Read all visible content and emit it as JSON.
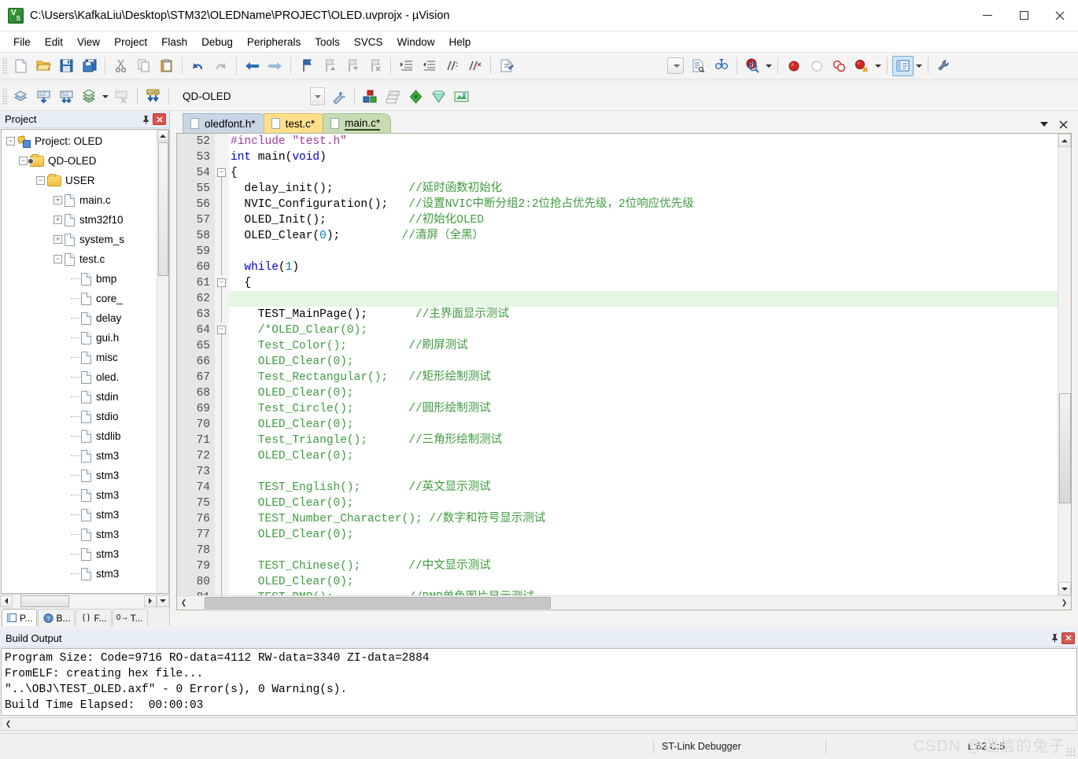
{
  "window": {
    "title": "C:\\Users\\KafkaLiu\\Desktop\\STM32\\OLEDName\\PROJECT\\OLED.uvprojx - µVision",
    "icon": "uvision-icon",
    "minimize": "–",
    "maximize": "□",
    "close": "✕"
  },
  "menu": [
    "File",
    "Edit",
    "View",
    "Project",
    "Flash",
    "Debug",
    "Peripherals",
    "Tools",
    "SVCS",
    "Window",
    "Help"
  ],
  "toolbar_main": [
    {
      "name": "new-file-icon",
      "glyph": "new"
    },
    {
      "name": "open-file-icon",
      "glyph": "open"
    },
    {
      "name": "save-icon",
      "glyph": "save"
    },
    {
      "name": "save-all-icon",
      "glyph": "saveall"
    },
    {
      "name": "sep",
      "glyph": "sep"
    },
    {
      "name": "cut-icon",
      "glyph": "cut"
    },
    {
      "name": "copy-icon",
      "glyph": "copy"
    },
    {
      "name": "paste-icon",
      "glyph": "paste"
    },
    {
      "name": "sep",
      "glyph": "sep"
    },
    {
      "name": "undo-icon",
      "glyph": "undo"
    },
    {
      "name": "redo-icon",
      "glyph": "redo"
    },
    {
      "name": "sep",
      "glyph": "sep"
    },
    {
      "name": "navigate-back-icon",
      "glyph": "back"
    },
    {
      "name": "navigate-forward-icon",
      "glyph": "fwd"
    },
    {
      "name": "sep",
      "glyph": "sep"
    },
    {
      "name": "bookmark-toggle-icon",
      "glyph": "bm1"
    },
    {
      "name": "bookmark-prev-icon",
      "glyph": "bm2"
    },
    {
      "name": "bookmark-next-icon",
      "glyph": "bm3"
    },
    {
      "name": "bookmark-clear-icon",
      "glyph": "bm4"
    },
    {
      "name": "sep",
      "glyph": "sep"
    },
    {
      "name": "indent-right-icon",
      "glyph": "ind1"
    },
    {
      "name": "indent-left-icon",
      "glyph": "ind2"
    },
    {
      "name": "comment-lines-icon",
      "glyph": "cmt1"
    },
    {
      "name": "uncomment-lines-icon",
      "glyph": "cmt2"
    },
    {
      "name": "sep",
      "glyph": "sep"
    },
    {
      "name": "open-include-file-icon",
      "glyph": "incl"
    }
  ],
  "toolbar_main_right": [
    {
      "name": "target-dropdown-icon",
      "glyph": "cbtn"
    },
    {
      "name": "insert-readwrite-breakpoint-icon",
      "glyph": "doc1"
    },
    {
      "name": "find-in-files-icon",
      "glyph": "binoc"
    },
    {
      "name": "sep",
      "glyph": "sep"
    },
    {
      "name": "debug-query-icon",
      "glyph": "magq"
    },
    {
      "name": "arrow",
      "glyph": "arrow"
    },
    {
      "name": "sep",
      "glyph": "sep"
    },
    {
      "name": "insert-breakpoint-icon",
      "glyph": "bp-red"
    },
    {
      "name": "disable-breakpoint-icon",
      "glyph": "bp-hollow"
    },
    {
      "name": "disable-all-breakpoints-icon",
      "glyph": "bp-two"
    },
    {
      "name": "kill-all-breakpoints-icon",
      "glyph": "bp-x"
    },
    {
      "name": "arrow",
      "glyph": "arrow"
    },
    {
      "name": "sep",
      "glyph": "sep"
    },
    {
      "name": "project-window-icon",
      "glyph": "panel",
      "active": true
    },
    {
      "name": "arrow",
      "glyph": "arrow"
    },
    {
      "name": "sep",
      "glyph": "sep"
    },
    {
      "name": "configure-target-icon",
      "glyph": "wrench"
    }
  ],
  "toolbar_build": [
    {
      "name": "translate-file-icon",
      "glyph": "trans"
    },
    {
      "name": "build-target-icon",
      "glyph": "build"
    },
    {
      "name": "rebuild-all-icon",
      "glyph": "rebuild"
    },
    {
      "name": "batch-build-icon",
      "glyph": "batch"
    },
    {
      "name": "arrow",
      "glyph": "arrow"
    },
    {
      "name": "stop-build-icon",
      "glyph": "stopbuild"
    },
    {
      "name": "sep",
      "glyph": "sep"
    },
    {
      "name": "download-icon",
      "glyph": "load"
    },
    {
      "name": "sep",
      "glyph": "sep"
    }
  ],
  "target_select": {
    "value": "QD-OLED",
    "name": "target-combo"
  },
  "toolbar_build_right": [
    {
      "name": "target-options-icon",
      "glyph": "magic"
    },
    {
      "name": "sep",
      "glyph": "sep"
    },
    {
      "name": "manage-project-items-icon",
      "glyph": "cubes"
    },
    {
      "name": "manage-multi-project-icon",
      "glyph": "layers"
    },
    {
      "name": "pack-installer-icon",
      "glyph": "diamond-green"
    },
    {
      "name": "manage-run-time-env-icon",
      "glyph": "diamond-light"
    },
    {
      "name": "select-software-packs-icon",
      "glyph": "packs"
    }
  ],
  "project_panel": {
    "title": "Project",
    "pin": "📌",
    "close": "✕",
    "tree": [
      {
        "label": "Project: OLED",
        "indent": 0,
        "expander": "-",
        "icon": "project-icon"
      },
      {
        "label": "QD-OLED",
        "indent": 1,
        "expander": "-",
        "icon": "target-folder-icon"
      },
      {
        "label": "USER",
        "indent": 2,
        "expander": "-",
        "icon": "group-folder-icon"
      },
      {
        "label": "main.c",
        "indent": 3,
        "expander": "+",
        "icon": "c-file-icon"
      },
      {
        "label": "stm32f10",
        "indent": 3,
        "expander": "+",
        "icon": "c-file-icon"
      },
      {
        "label": "system_s",
        "indent": 3,
        "expander": "+",
        "icon": "c-file-icon"
      },
      {
        "label": "test.c",
        "indent": 3,
        "expander": "-",
        "icon": "c-file-icon"
      },
      {
        "label": "bmp",
        "indent": 4,
        "expander": "",
        "icon": "h-file-icon"
      },
      {
        "label": "core_",
        "indent": 4,
        "expander": "",
        "icon": "h-file-icon"
      },
      {
        "label": "delay",
        "indent": 4,
        "expander": "",
        "icon": "h-file-icon"
      },
      {
        "label": "gui.h",
        "indent": 4,
        "expander": "",
        "icon": "h-file-icon"
      },
      {
        "label": "misc",
        "indent": 4,
        "expander": "",
        "icon": "h-file-icon"
      },
      {
        "label": "oled.",
        "indent": 4,
        "expander": "",
        "icon": "h-file-icon"
      },
      {
        "label": "stdin",
        "indent": 4,
        "expander": "",
        "icon": "h-file-icon"
      },
      {
        "label": "stdio",
        "indent": 4,
        "expander": "",
        "icon": "h-file-icon"
      },
      {
        "label": "stdlib",
        "indent": 4,
        "expander": "",
        "icon": "h-file-icon"
      },
      {
        "label": "stm3",
        "indent": 4,
        "expander": "",
        "icon": "h-file-icon"
      },
      {
        "label": "stm3",
        "indent": 4,
        "expander": "",
        "icon": "h-file-icon"
      },
      {
        "label": "stm3",
        "indent": 4,
        "expander": "",
        "icon": "h-file-icon"
      },
      {
        "label": "stm3",
        "indent": 4,
        "expander": "",
        "icon": "h-file-icon"
      },
      {
        "label": "stm3",
        "indent": 4,
        "expander": "",
        "icon": "h-file-icon"
      },
      {
        "label": "stm3",
        "indent": 4,
        "expander": "",
        "icon": "h-file-icon"
      },
      {
        "label": "stm3",
        "indent": 4,
        "expander": "",
        "icon": "h-file-icon"
      }
    ],
    "tabs": [
      {
        "label": "P...",
        "icon": "project-tab-icon",
        "selected": true
      },
      {
        "label": "B...",
        "icon": "books-tab-icon",
        "selected": false
      },
      {
        "label": "F...",
        "icon": "functions-tab-icon",
        "selected": false
      },
      {
        "label": "T...",
        "icon": "templates-tab-icon",
        "selected": false
      }
    ]
  },
  "editor": {
    "tabs": [
      {
        "label": "oledfont.h*",
        "style": "t1"
      },
      {
        "label": "test.c*",
        "style": "t2"
      },
      {
        "label": "main.c*",
        "style": "t3",
        "active": true
      }
    ],
    "tab_controls": [
      {
        "name": "tab-list-dropdown-icon",
        "glyph": "▼"
      },
      {
        "name": "close-document-icon",
        "glyph": "✕"
      }
    ],
    "first_line": 52,
    "highlight_line": 62,
    "lines": [
      {
        "n": 52,
        "fold": "",
        "segs": [
          {
            "t": "pre",
            "v": "#include "
          },
          {
            "t": "str",
            "v": "\"test.h\""
          }
        ]
      },
      {
        "n": 53,
        "fold": "",
        "segs": [
          {
            "t": "kw",
            "v": "int"
          },
          {
            "t": "pln",
            "v": " main("
          },
          {
            "t": "kw",
            "v": "void"
          },
          {
            "t": "pln",
            "v": ")"
          }
        ]
      },
      {
        "n": 54,
        "fold": "minus",
        "segs": [
          {
            "t": "pln",
            "v": "{"
          }
        ]
      },
      {
        "n": 55,
        "fold": "line",
        "segs": [
          {
            "t": "pln",
            "v": "  delay_init();           "
          },
          {
            "t": "cmt",
            "v": "//延时函数初始化"
          }
        ]
      },
      {
        "n": 56,
        "fold": "line",
        "segs": [
          {
            "t": "pln",
            "v": "  NVIC_Configuration();   "
          },
          {
            "t": "cmt",
            "v": "//设置NVIC中断分组2:2位抢占优先级，2位响应优先级"
          }
        ]
      },
      {
        "n": 57,
        "fold": "line",
        "segs": [
          {
            "t": "pln",
            "v": "  OLED_Init();            "
          },
          {
            "t": "cmt",
            "v": "//初始化OLED"
          }
        ]
      },
      {
        "n": 58,
        "fold": "line",
        "segs": [
          {
            "t": "pln",
            "v": "  OLED_Clear("
          },
          {
            "t": "num",
            "v": "0"
          },
          {
            "t": "pln",
            "v": ");         "
          },
          {
            "t": "cmt",
            "v": "//清屏（全黑）"
          }
        ]
      },
      {
        "n": 59,
        "fold": "line",
        "segs": []
      },
      {
        "n": 60,
        "fold": "line",
        "segs": [
          {
            "t": "pln",
            "v": "  "
          },
          {
            "t": "kw",
            "v": "while"
          },
          {
            "t": "pln",
            "v": "("
          },
          {
            "t": "num",
            "v": "1"
          },
          {
            "t": "pln",
            "v": ")"
          }
        ]
      },
      {
        "n": 61,
        "fold": "minus",
        "segs": [
          {
            "t": "pln",
            "v": "  {"
          }
        ]
      },
      {
        "n": 62,
        "fold": "line",
        "segs": []
      },
      {
        "n": 63,
        "fold": "line",
        "segs": [
          {
            "t": "pln",
            "v": "    TEST_MainPage();       "
          },
          {
            "t": "cmt",
            "v": "//主界面显示测试"
          }
        ]
      },
      {
        "n": 64,
        "fold": "minus",
        "segs": [
          {
            "t": "cmt",
            "v": "    /*OLED_Clear(0);"
          }
        ]
      },
      {
        "n": 65,
        "fold": "line",
        "segs": [
          {
            "t": "cmt",
            "v": "    Test_Color();         "
          },
          {
            "t": "cmt",
            "v": "//刷屏测试"
          }
        ]
      },
      {
        "n": 66,
        "fold": "line",
        "segs": [
          {
            "t": "cmt",
            "v": "    OLED_Clear(0);"
          }
        ]
      },
      {
        "n": 67,
        "fold": "line",
        "segs": [
          {
            "t": "cmt",
            "v": "    Test_Rectangular();   "
          },
          {
            "t": "cmt",
            "v": "//矩形绘制测试"
          }
        ]
      },
      {
        "n": 68,
        "fold": "line",
        "segs": [
          {
            "t": "cmt",
            "v": "    OLED_Clear(0);"
          }
        ]
      },
      {
        "n": 69,
        "fold": "line",
        "segs": [
          {
            "t": "cmt",
            "v": "    Test_Circle();        "
          },
          {
            "t": "cmt",
            "v": "//圆形绘制测试"
          }
        ]
      },
      {
        "n": 70,
        "fold": "line",
        "segs": [
          {
            "t": "cmt",
            "v": "    OLED_Clear(0);"
          }
        ]
      },
      {
        "n": 71,
        "fold": "line",
        "segs": [
          {
            "t": "cmt",
            "v": "    Test_Triangle();      "
          },
          {
            "t": "cmt",
            "v": "//三角形绘制测试"
          }
        ]
      },
      {
        "n": 72,
        "fold": "line",
        "segs": [
          {
            "t": "cmt",
            "v": "    OLED_Clear(0);"
          }
        ]
      },
      {
        "n": 73,
        "fold": "line",
        "segs": []
      },
      {
        "n": 74,
        "fold": "line",
        "segs": [
          {
            "t": "cmt",
            "v": "    TEST_English();       "
          },
          {
            "t": "cmt",
            "v": "//英文显示测试"
          }
        ]
      },
      {
        "n": 75,
        "fold": "line",
        "segs": [
          {
            "t": "cmt",
            "v": "    OLED_Clear(0);"
          }
        ]
      },
      {
        "n": 76,
        "fold": "line",
        "segs": [
          {
            "t": "cmt",
            "v": "    TEST_Number_Character(); "
          },
          {
            "t": "cmt",
            "v": "//数字和符号显示测试"
          }
        ]
      },
      {
        "n": 77,
        "fold": "line",
        "segs": [
          {
            "t": "cmt",
            "v": "    OLED_Clear(0);"
          }
        ]
      },
      {
        "n": 78,
        "fold": "line",
        "segs": []
      },
      {
        "n": 79,
        "fold": "line",
        "segs": [
          {
            "t": "cmt",
            "v": "    TEST_Chinese();       "
          },
          {
            "t": "cmt",
            "v": "//中文显示测试"
          }
        ]
      },
      {
        "n": 80,
        "fold": "line",
        "segs": [
          {
            "t": "cmt",
            "v": "    OLED_Clear(0);"
          }
        ]
      },
      {
        "n": 81,
        "fold": "line",
        "segs": [
          {
            "t": "cmt",
            "v": "    TEST_BMP();           "
          },
          {
            "t": "cmt",
            "v": "//BMP单色图片显示测试"
          }
        ]
      }
    ]
  },
  "build_output": {
    "title": "Build Output",
    "pin": "📌",
    "close": "✕",
    "lines": [
      "Program Size: Code=9716 RO-data=4112 RW-data=3340 ZI-data=2884",
      "FromELF: creating hex file...",
      "\"..\\OBJ\\TEST_OLED.axf\" - 0 Error(s), 0 Warning(s).",
      "Build Time Elapsed:  00:00:03"
    ]
  },
  "statusbar": {
    "debugger": "ST-Link Debugger",
    "cursor": "L:62 C:5",
    "watermark": "CSDN @迷信的兔子"
  },
  "colors": {
    "keyword": "#0000ce",
    "comment": "#3d9c3d",
    "preprocessor": "#9b3a9b",
    "number": "#0b7ab5",
    "highlight_line": "#e3f7e3",
    "tab_active": "#c8dcb4"
  }
}
